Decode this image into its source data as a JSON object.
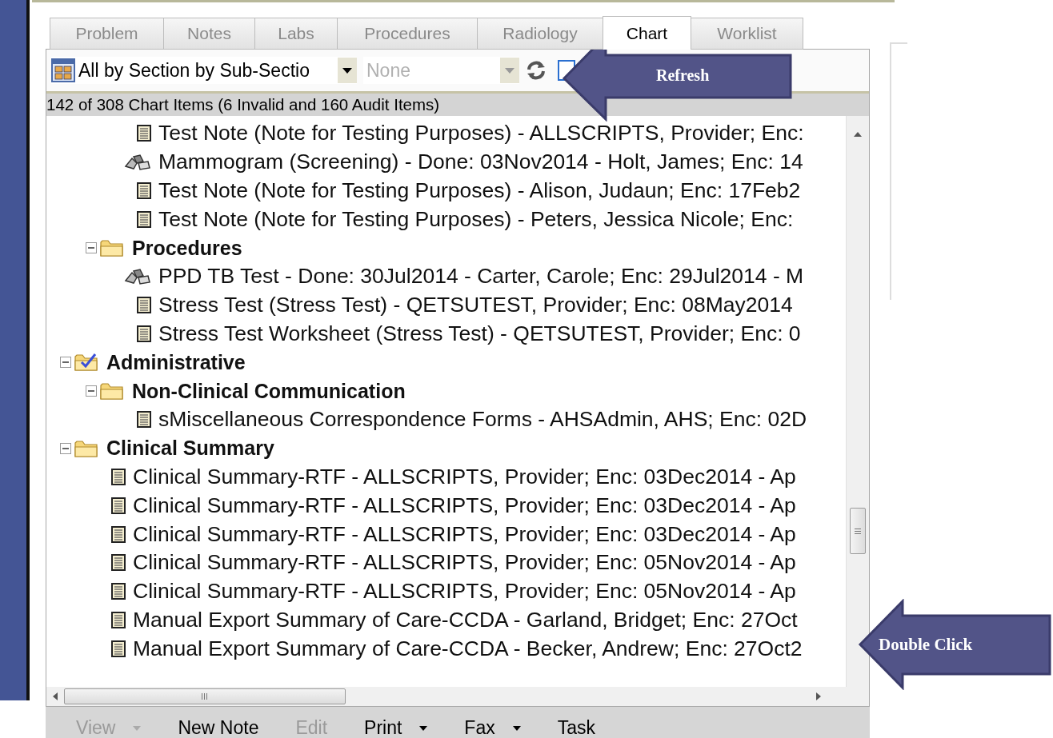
{
  "tabs": [
    {
      "label": "Problem",
      "selected": false
    },
    {
      "label": "Notes",
      "selected": false
    },
    {
      "label": "Labs",
      "selected": false
    },
    {
      "label": "Procedures",
      "selected": false
    },
    {
      "label": "Radiology",
      "selected": false
    },
    {
      "label": "Chart",
      "selected": true
    },
    {
      "label": "Worklist",
      "selected": false
    }
  ],
  "toolbar": {
    "view_select": {
      "value": "All by Section by Sub-Sectio"
    },
    "filter_select": {
      "value": "None",
      "disabled": true
    }
  },
  "status": "142 of 308 Chart Items (6 Invalid and 160 Audit Items)",
  "tree": {
    "continued_items": [
      {
        "kind": "note",
        "label": "Test Note (Note for Testing Purposes) - ALLSCRIPTS, Provider; Enc:"
      },
      {
        "kind": "procedure",
        "label": "Mammogram (Screening) - Done: 03Nov2014 - Holt, James; Enc: 14"
      },
      {
        "kind": "note",
        "label": "Test Note (Note for Testing Purposes) - Alison, Judaun; Enc: 17Feb2"
      },
      {
        "kind": "note",
        "label": "Test Note (Note for Testing Purposes) - Peters, Jessica Nicole; Enc:"
      }
    ],
    "continued_folders": [
      {
        "kind": "folder",
        "expanded": true,
        "label": "Procedures",
        "children": [
          {
            "kind": "procedure",
            "label": "PPD TB Test - Done: 30Jul2014 - Carter, Carole; Enc: 29Jul2014 - M"
          },
          {
            "kind": "note",
            "label": "Stress Test (Stress Test) - QETSUTEST, Provider; Enc: 08May2014"
          },
          {
            "kind": "note",
            "label": "Stress Test Worksheet (Stress Test) - QETSUTEST, Provider; Enc: 0"
          }
        ]
      }
    ],
    "folders": [
      {
        "kind": "task_folder",
        "expanded": true,
        "label": "Administrative",
        "children": [
          {
            "kind": "folder",
            "expanded": true,
            "label": "Non-Clinical Communication",
            "children": [
              {
                "kind": "note",
                "label": "sMiscellaneous Correspondence Forms - AHSAdmin, AHS; Enc: 02D"
              }
            ]
          }
        ]
      },
      {
        "kind": "folder",
        "expanded": true,
        "label": "Clinical Summary",
        "children": [
          {
            "kind": "note",
            "label": "Clinical Summary-RTF - ALLSCRIPTS, Provider; Enc: 03Dec2014 - Ap"
          },
          {
            "kind": "note",
            "label": "Clinical Summary-RTF - ALLSCRIPTS, Provider; Enc: 03Dec2014 - Ap"
          },
          {
            "kind": "note",
            "label": "Clinical Summary-RTF - ALLSCRIPTS, Provider; Enc: 03Dec2014 - Ap"
          },
          {
            "kind": "note",
            "label": "Clinical Summary-RTF - ALLSCRIPTS, Provider; Enc: 05Nov2014 - Ap"
          },
          {
            "kind": "note",
            "label": "Clinical Summary-RTF - ALLSCRIPTS, Provider; Enc: 05Nov2014 - Ap"
          },
          {
            "kind": "note",
            "label": "Manual Export Summary of Care-CCDA - Garland, Bridget; Enc: 27Oct"
          },
          {
            "kind": "note",
            "label": "Manual Export Summary of Care-CCDA - Becker, Andrew; Enc: 27Oct2"
          }
        ]
      }
    ]
  },
  "bottom_toolbar": [
    {
      "label": "View",
      "disabled": true,
      "menu": true
    },
    {
      "label": "New Note",
      "disabled": false,
      "menu": false
    },
    {
      "label": "Edit",
      "disabled": true,
      "menu": false
    },
    {
      "label": "Print",
      "disabled": false,
      "menu": true
    },
    {
      "label": "Fax",
      "disabled": false,
      "menu": true
    },
    {
      "label": "Task",
      "disabled": false,
      "menu": false
    }
  ],
  "callouts": [
    {
      "kind": "refresh",
      "label": "Refresh"
    },
    {
      "kind": "double_click",
      "label": "Double Click"
    }
  ]
}
